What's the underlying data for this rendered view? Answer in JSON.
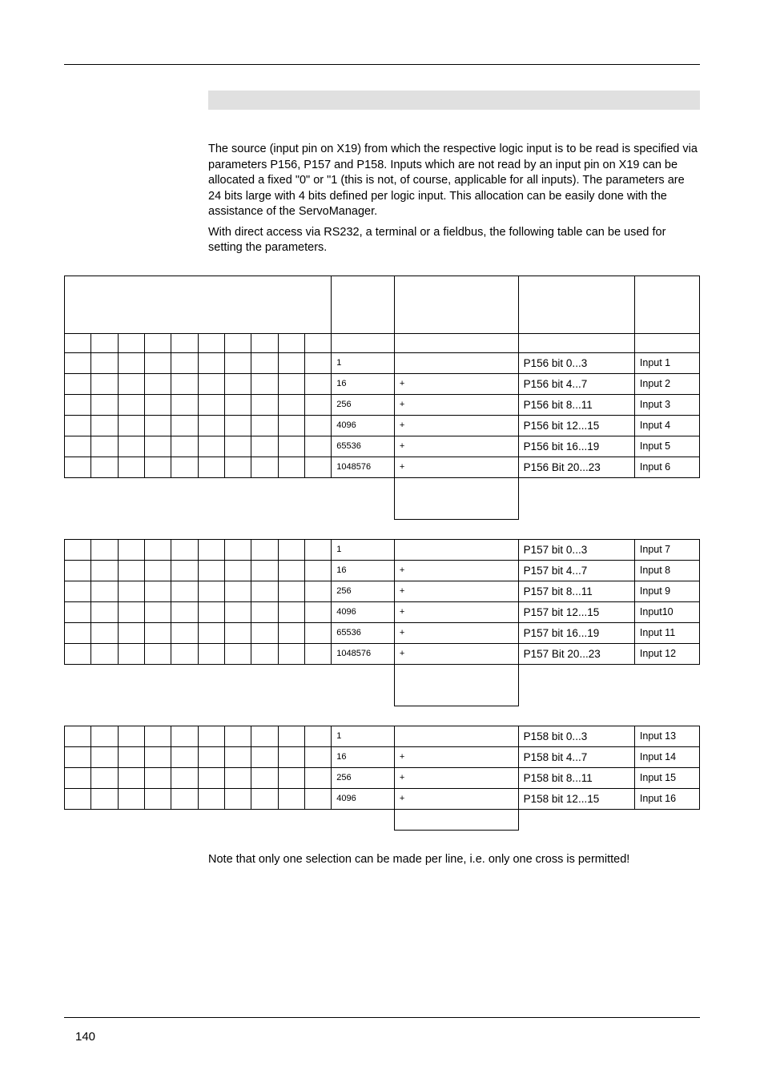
{
  "intro": {
    "p1": "The source (input pin on X19) from which the respective logic input is to be read is specified via parameters P156, P157 and P158. Inputs which are not read by an input pin on X19 can be allocated a fixed \"0\" or \"1 (this is not, of course, applicable for all inputs). The parameters are 24 bits large  with 4 bits defined per logic input. This allocation can be easily done with the assistance of the ServoManager.",
    "p2": "With direct access via RS232, a terminal or a fieldbus, the following table can be used for setting the parameters."
  },
  "block1": {
    "rows": [
      {
        "num": "1",
        "plus": "",
        "param": "P156 bit 0...3",
        "input": "Input 1"
      },
      {
        "num": "16",
        "plus": "+",
        "param": "P156 bit 4...7",
        "input": "Input 2"
      },
      {
        "num": "256",
        "plus": "+",
        "param": "P156 bit 8...11",
        "input": "Input 3"
      },
      {
        "num": "4096",
        "plus": "+",
        "param": "P156 bit 12...15",
        "input": "Input 4"
      },
      {
        "num": "65536",
        "plus": "+",
        "param": "P156 bit 16...19",
        "input": "Input 5"
      },
      {
        "num": "1048576",
        "plus": "+",
        "param": "P156 Bit 20...23",
        "input": "Input 6"
      }
    ]
  },
  "block2": {
    "rows": [
      {
        "num": "1",
        "plus": "",
        "param": "P157 bit 0...3",
        "input": "Input 7"
      },
      {
        "num": "16",
        "plus": "+",
        "param": "P157 bit 4...7",
        "input": "Input 8"
      },
      {
        "num": "256",
        "plus": "+",
        "param": "P157 bit 8...11",
        "input": "Input 9"
      },
      {
        "num": "4096",
        "plus": "+",
        "param": "P157 bit 12...15",
        "input": "Input10"
      },
      {
        "num": "65536",
        "plus": "+",
        "param": "P157 bit 16...19",
        "input": "Input 11"
      },
      {
        "num": "1048576",
        "plus": "+",
        "param": "P157 Bit 20...23",
        "input": "Input 12"
      }
    ]
  },
  "block3": {
    "rows": [
      {
        "num": "1",
        "plus": "",
        "param": "P158 bit 0...3",
        "input": "Input 13"
      },
      {
        "num": "16",
        "plus": "+",
        "param": "P158 bit 4...7",
        "input": "Input 14"
      },
      {
        "num": "256",
        "plus": "+",
        "param": "P158 bit 8...11",
        "input": "Input 15"
      },
      {
        "num": "4096",
        "plus": "+",
        "param": "P158 bit 12...15",
        "input": "Input 16"
      }
    ]
  },
  "footnote": "Note that only one selection can be made per line, i.e. only one cross is permitted!",
  "pageNumber": "140"
}
